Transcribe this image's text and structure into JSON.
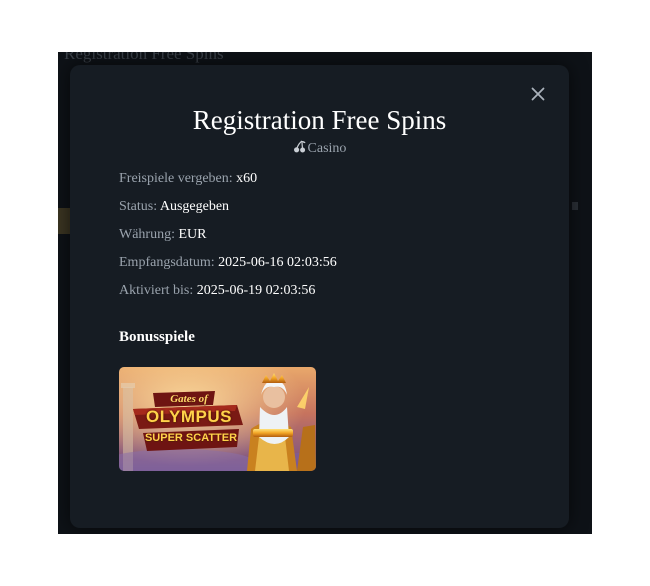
{
  "background": {
    "title": "Registration Free Spins"
  },
  "modal": {
    "title": "Registration Free Spins",
    "category": "Casino",
    "category_icon": "cherry-icon",
    "close_icon": "close-icon",
    "details": [
      {
        "label": "Freispiele vergeben:",
        "value": "x60"
      },
      {
        "label": "Status:",
        "value": "Ausgegeben"
      },
      {
        "label": "Währung:",
        "value": "EUR"
      },
      {
        "label": "Empfangsdatum:",
        "value": "2025-06-16 02:03:56"
      },
      {
        "label": "Aktiviert bis:",
        "value": "2025-06-19 02:03:56"
      }
    ],
    "bonus_section_title": "Bonusspiele",
    "games": [
      {
        "line1": "Gates of",
        "line2": "OLYMPUS",
        "line3": "SUPER SCATTER"
      }
    ]
  },
  "colors": {
    "backdrop": "#0e1217",
    "modal_bg": "#161c23",
    "label": "#9aa3ad",
    "value": "#ffffff"
  }
}
